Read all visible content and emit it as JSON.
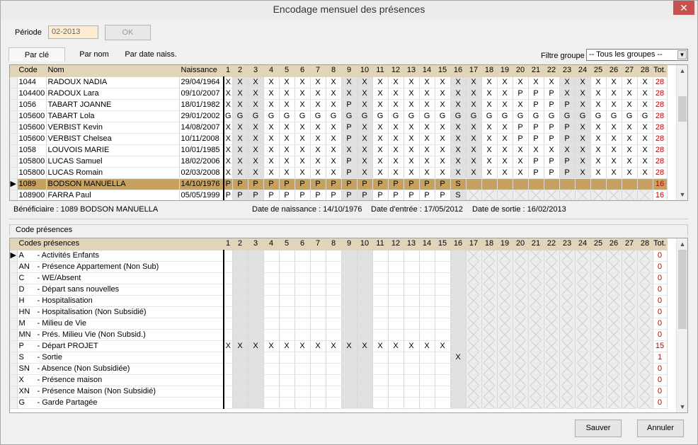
{
  "window": {
    "title": "Encodage mensuel des présences",
    "close_icon": "✕"
  },
  "periode": {
    "label": "Période",
    "value": "02-2013",
    "ok_label": "OK"
  },
  "tabs": [
    "Par clé",
    "Par nom",
    "Par date naiss."
  ],
  "filter": {
    "label": "Filtre groupe",
    "value": "-- Tous les groupes --",
    "arrow": "▼"
  },
  "grid1": {
    "headers": {
      "code": "Code",
      "nom": "Nom",
      "naissance": "Naissance",
      "tot": "Tot."
    },
    "days": [
      "1",
      "2",
      "3",
      "4",
      "5",
      "6",
      "7",
      "8",
      "9",
      "10",
      "11",
      "12",
      "13",
      "14",
      "15",
      "16",
      "17",
      "18",
      "19",
      "20",
      "21",
      "22",
      "23",
      "24",
      "25",
      "26",
      "27",
      "28"
    ],
    "weekend_days": [
      2,
      3,
      9,
      10,
      16,
      17,
      23,
      24
    ],
    "selected_marker": "▶",
    "rows": [
      {
        "code": "1044",
        "nom": "RADOUX NADIA",
        "naissance": "29/04/1964",
        "days": "XXXXXXXXXXXXXXXXXXXXXXXXXXXX",
        "tot": "28"
      },
      {
        "code": "104400",
        "nom": "RADOUX Lara",
        "naissance": "09/10/2007",
        "days": "XXXXXXXXXXXXXXXXXXXPPPXXXXXX",
        "tot": "28"
      },
      {
        "code": "1056",
        "nom": "TABART JOANNE",
        "naissance": "18/01/1982",
        "days": "XXXXXXXXPXXXXXXXXXXXPPPXXXXX",
        "tot": "28"
      },
      {
        "code": "105600",
        "nom": "TABART Lola",
        "naissance": "29/01/2002",
        "days": "GGGGGGGGGGGGGGGGGGGGGGGGGGGG",
        "tot": "28"
      },
      {
        "code": "105600",
        "nom": "VERBIST Kevin",
        "naissance": "14/08/2007",
        "days": "XXXXXXXXPXXXXXXXXXXPPPPXXXXX",
        "tot": "28"
      },
      {
        "code": "105600",
        "nom": "VERBIST Chelsea",
        "naissance": "10/11/2008",
        "days": "XXXXXXXXPXXXXXXXXXXPPPPXXXXX",
        "tot": "28"
      },
      {
        "code": "1058",
        "nom": "LOUVOIS MARIE",
        "naissance": "10/01/1985",
        "days": "XXXXXXXXXXXXXXXXXXXXXXXXXXXX",
        "tot": "28"
      },
      {
        "code": "105800",
        "nom": "LUCAS Samuel",
        "naissance": "18/02/2006",
        "days": "XXXXXXXXPXXXXXXXXXXXPPPXXXXX",
        "tot": "28"
      },
      {
        "code": "105800",
        "nom": "LUCAS Romain",
        "naissance": "02/03/2008",
        "days": "XXXXXXXXPXXXXXXXXXXXPPPXXXXX",
        "tot": "28"
      },
      {
        "code": "1089",
        "nom": "BODSON MANUELLA",
        "naissance": "14/10/1976",
        "days": "PPPPPPPPPPPPPPPS",
        "tot": "16",
        "selected": true
      },
      {
        "code": "108900",
        "nom": "FARRA Paul",
        "naissance": "05/05/1999",
        "days": "PPPPPPPPPPPPPPPS",
        "tot": "16"
      }
    ]
  },
  "info": {
    "beneficiaire": "Bénéficiaire : 1089 BODSON MANUELLA",
    "naissance": "Date de naissance : 14/10/1976",
    "entree": "Date d'entrée : 17/05/2012",
    "sortie": "Date de sortie : 16/02/2013"
  },
  "codes_section": {
    "title": "Code présences"
  },
  "grid2": {
    "headers": {
      "codes": "Codes présences",
      "tot": "Tot."
    },
    "selected_marker": "▶",
    "rows": [
      {
        "code": "A",
        "label": "Activités Enfants",
        "days": "",
        "tot": "0",
        "selected": true
      },
      {
        "code": "AN",
        "label": "Présence Appartement (Non Sub)",
        "days": "",
        "tot": "0"
      },
      {
        "code": "C",
        "label": "WE/Absent",
        "days": "",
        "tot": "0"
      },
      {
        "code": "D",
        "label": "Départ sans nouvelles",
        "days": "",
        "tot": "0"
      },
      {
        "code": "H",
        "label": "Hospitalisation",
        "days": "",
        "tot": "0"
      },
      {
        "code": "HN",
        "label": "Hospitalisation (Non Subsidié)",
        "days": "",
        "tot": "0"
      },
      {
        "code": "M",
        "label": "Milieu de Vie",
        "days": "",
        "tot": "0"
      },
      {
        "code": "MN",
        "label": "Prés. Milieu Vie (Non Subsid.)",
        "days": "",
        "tot": "0"
      },
      {
        "code": "P",
        "label": "Départ PROJET",
        "days": "XXXXXXXXXXXXXXX",
        "tot": "15"
      },
      {
        "code": "S",
        "label": "Sortie",
        "days": "               X",
        "tot": "1"
      },
      {
        "code": "SN",
        "label": "Absence (Non Subsidiée)",
        "days": "",
        "tot": "0"
      },
      {
        "code": "X",
        "label": "Présence maison",
        "days": "",
        "tot": "0"
      },
      {
        "code": "XN",
        "label": "Présence Maison (Non Subsidié)",
        "days": "",
        "tot": "0"
      },
      {
        "code": "G",
        "label": "Garde Partagée",
        "days": "",
        "tot": "0"
      }
    ]
  },
  "buttons": {
    "save": "Sauver",
    "cancel": "Annuler"
  },
  "scroll": {
    "up": "▲",
    "down": "▼"
  }
}
